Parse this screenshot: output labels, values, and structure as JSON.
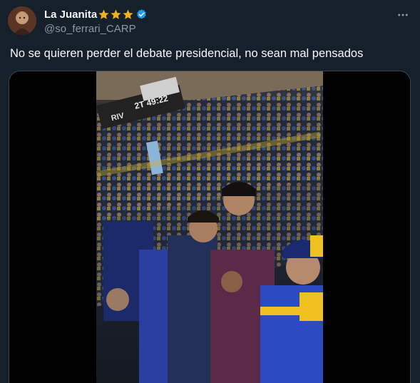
{
  "author": {
    "display_name": "La Juanita",
    "handle": "@so_ferrari_CARP",
    "badges": [
      "star-icon",
      "star-icon",
      "star-icon",
      "verified-icon"
    ]
  },
  "tweet": {
    "text": "No se quieren perder el debate presidencial, no sean mal pensados"
  },
  "media": {
    "type": "video",
    "scoreboard_text": "2T 49:22",
    "scoreboard_team": "RIV"
  },
  "colors": {
    "background": "#15202b",
    "text_primary": "#f7f9f9",
    "text_secondary": "#8b98a5",
    "verified": "#1d9bf0",
    "star": "#f2b01e"
  }
}
